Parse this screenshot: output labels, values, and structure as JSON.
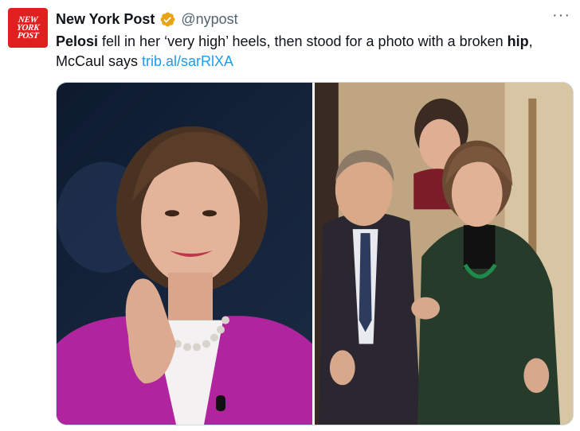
{
  "tweet": {
    "avatar": {
      "lines": [
        "NEW",
        "YORK",
        "POST"
      ],
      "color": "#e0201f"
    },
    "display_name": "New York Post",
    "verified_icon": "verified-badge-gold",
    "handle": "@nypost",
    "more_label": "···",
    "text": {
      "part1_bold": "Pelosi",
      "part2": " fell in her ‘very high’ heels, then stood for a photo with a broken ",
      "part3_bold": "hip",
      "part4": ", McCaul says ",
      "link": "trib.al/sarRlXA"
    },
    "colors": {
      "text": "#0f1419",
      "secondary": "#536471",
      "link": "#1d9bf0",
      "verified": "#e8a317"
    }
  }
}
